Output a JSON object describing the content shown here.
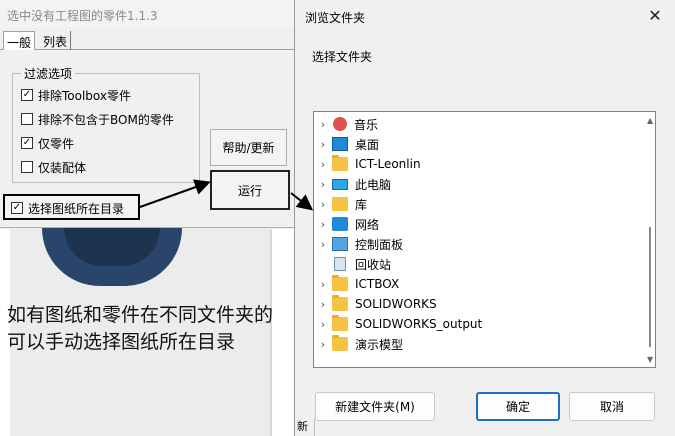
{
  "app": {
    "title": "选中没有工程图的零件1.1.3",
    "tabs": [
      "一般",
      "列表"
    ],
    "filter_group_title": "过滤选项",
    "options": [
      {
        "label": "排除Toolbox零件",
        "checked": true
      },
      {
        "label": "排除不包含于BOM的零件",
        "checked": false
      },
      {
        "label": "仅零件",
        "checked": true
      },
      {
        "label": "仅装配体",
        "checked": false
      }
    ],
    "select_dir_option": {
      "label": "选择图纸所在目录",
      "checked": true
    },
    "help_button": "帮助/更新",
    "run_button": "运行"
  },
  "annotation": {
    "line1": "如有图纸和零件在不同文件夹的",
    "line2": "可以手动选择图纸所在目录"
  },
  "dialog": {
    "title": "浏览文件夹",
    "close_glyph": "✕",
    "prompt": "选择文件夹",
    "tree": [
      {
        "label": "音乐",
        "icon": "music-icon",
        "expandable": true
      },
      {
        "label": "桌面",
        "icon": "desktop-icon",
        "expandable": true
      },
      {
        "label": "ICT-Leonlin",
        "icon": "folder-icon",
        "expandable": true
      },
      {
        "label": "此电脑",
        "icon": "computer-icon",
        "expandable": true
      },
      {
        "label": "库",
        "icon": "library-icon",
        "expandable": true
      },
      {
        "label": "网络",
        "icon": "network-icon",
        "expandable": true
      },
      {
        "label": "控制面板",
        "icon": "control-panel-icon",
        "expandable": true
      },
      {
        "label": "回收站",
        "icon": "recycle-bin-icon",
        "expandable": false
      },
      {
        "label": "ICTBOX",
        "icon": "folder-icon",
        "expandable": true
      },
      {
        "label": "SOLIDWORKS",
        "icon": "folder-icon",
        "expandable": true
      },
      {
        "label": "SOLIDWORKS_output",
        "icon": "folder-icon",
        "expandable": true
      },
      {
        "label": "演示模型",
        "icon": "folder-icon",
        "expandable": true
      }
    ],
    "new_folder_button": "新建文件夹(M)",
    "ok_button": "确定",
    "cancel_button": "取消",
    "bottom_edge_text": "新"
  }
}
